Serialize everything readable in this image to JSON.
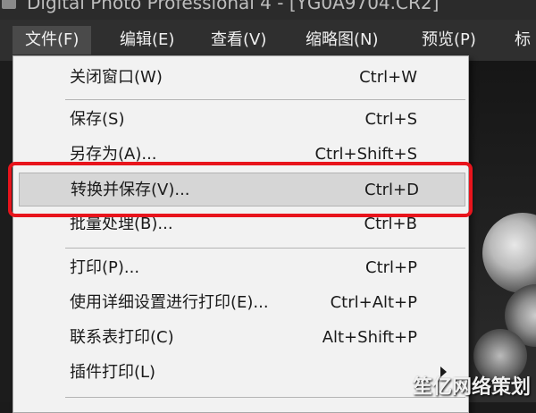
{
  "window": {
    "title": "Digital Photo Professional 4 - [YG0A9704.CR2]"
  },
  "menubar": {
    "items": [
      {
        "label": "文件(F)"
      },
      {
        "label": "编辑(E)"
      },
      {
        "label": "查看(V)"
      },
      {
        "label": "缩略图(N)"
      },
      {
        "label": "预览(P)"
      },
      {
        "label": "标"
      }
    ]
  },
  "file_menu": {
    "items": [
      {
        "label": "关闭窗口(W)",
        "shortcut": "Ctrl+W"
      },
      {
        "label": "保存(S)",
        "shortcut": "Ctrl+S"
      },
      {
        "label": "另存为(A)...",
        "shortcut": "Ctrl+Shift+S"
      },
      {
        "label": "转换并保存(V)...",
        "shortcut": "Ctrl+D"
      },
      {
        "label": "批量处理(B)...",
        "shortcut": "Ctrl+B"
      },
      {
        "label": "打印(P)...",
        "shortcut": "Ctrl+P"
      },
      {
        "label": "使用详细设置进行打印(E)...",
        "shortcut": "Ctrl+Alt+P"
      },
      {
        "label": "联系表打印(C)",
        "shortcut": "Alt+Shift+P"
      },
      {
        "label": "插件打印(L)",
        "shortcut": ""
      }
    ]
  },
  "annotation": {
    "color": "#e8141c"
  },
  "watermark": {
    "text": "笙亿网络策划"
  },
  "colors": {
    "menu_bg": "#f2f2f2",
    "menubar_bg": "#2f2f2f",
    "highlight_bg": "#d6d6d6"
  }
}
